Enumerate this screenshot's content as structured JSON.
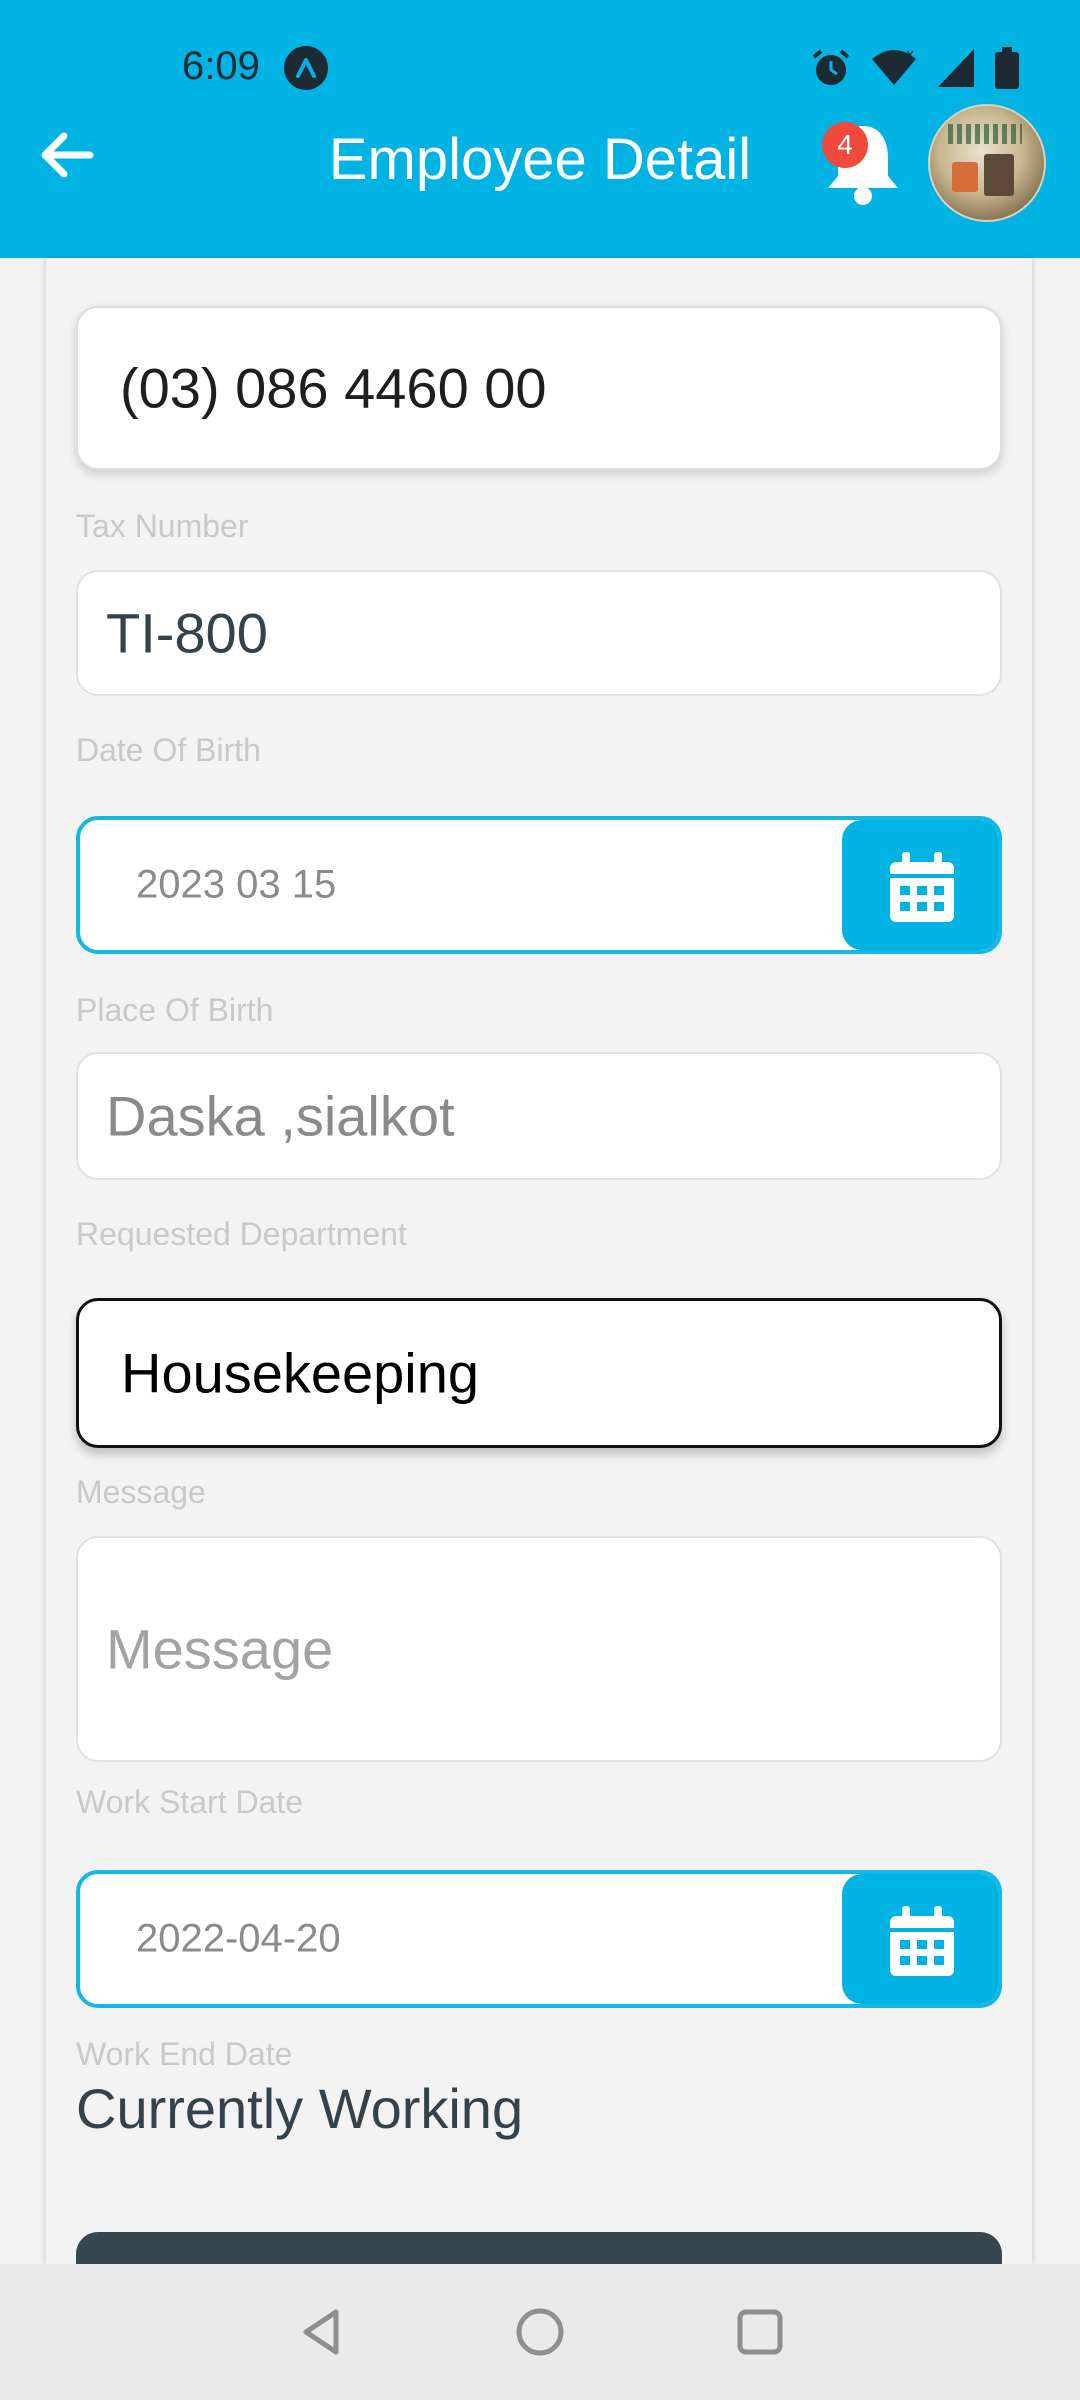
{
  "status_bar": {
    "time": "6:09"
  },
  "header": {
    "title": "Employee Detail",
    "notification_count": "4",
    "back_icon": "arrow-left-icon",
    "bell_icon": "bell-icon"
  },
  "form": {
    "phone": {
      "value": "(03) 086 4460 00"
    },
    "tax_number": {
      "label": "Tax Number",
      "value": "TI-800"
    },
    "date_of_birth": {
      "label": "Date Of Birth",
      "value": "2023 03 15"
    },
    "place_of_birth": {
      "label": "Place Of Birth",
      "value": "Daska ,sialkot"
    },
    "requested_department": {
      "label": "Requested Department",
      "value": "Housekeeping"
    },
    "message": {
      "label": "Message",
      "placeholder": "Message"
    },
    "work_start_date": {
      "label": "Work Start Date",
      "value": "2022-04-20"
    },
    "work_end_date": {
      "label": "Work End Date",
      "value": "Currently Working"
    }
  },
  "colors": {
    "accent": "#00b3e3",
    "badge": "#f0493e",
    "button_dark": "#36474f",
    "text_dark": "#34434b",
    "label": "#c9c9c9"
  },
  "nav": {
    "icons": [
      "back-triangle-icon",
      "home-circle-icon",
      "recents-square-icon"
    ]
  }
}
